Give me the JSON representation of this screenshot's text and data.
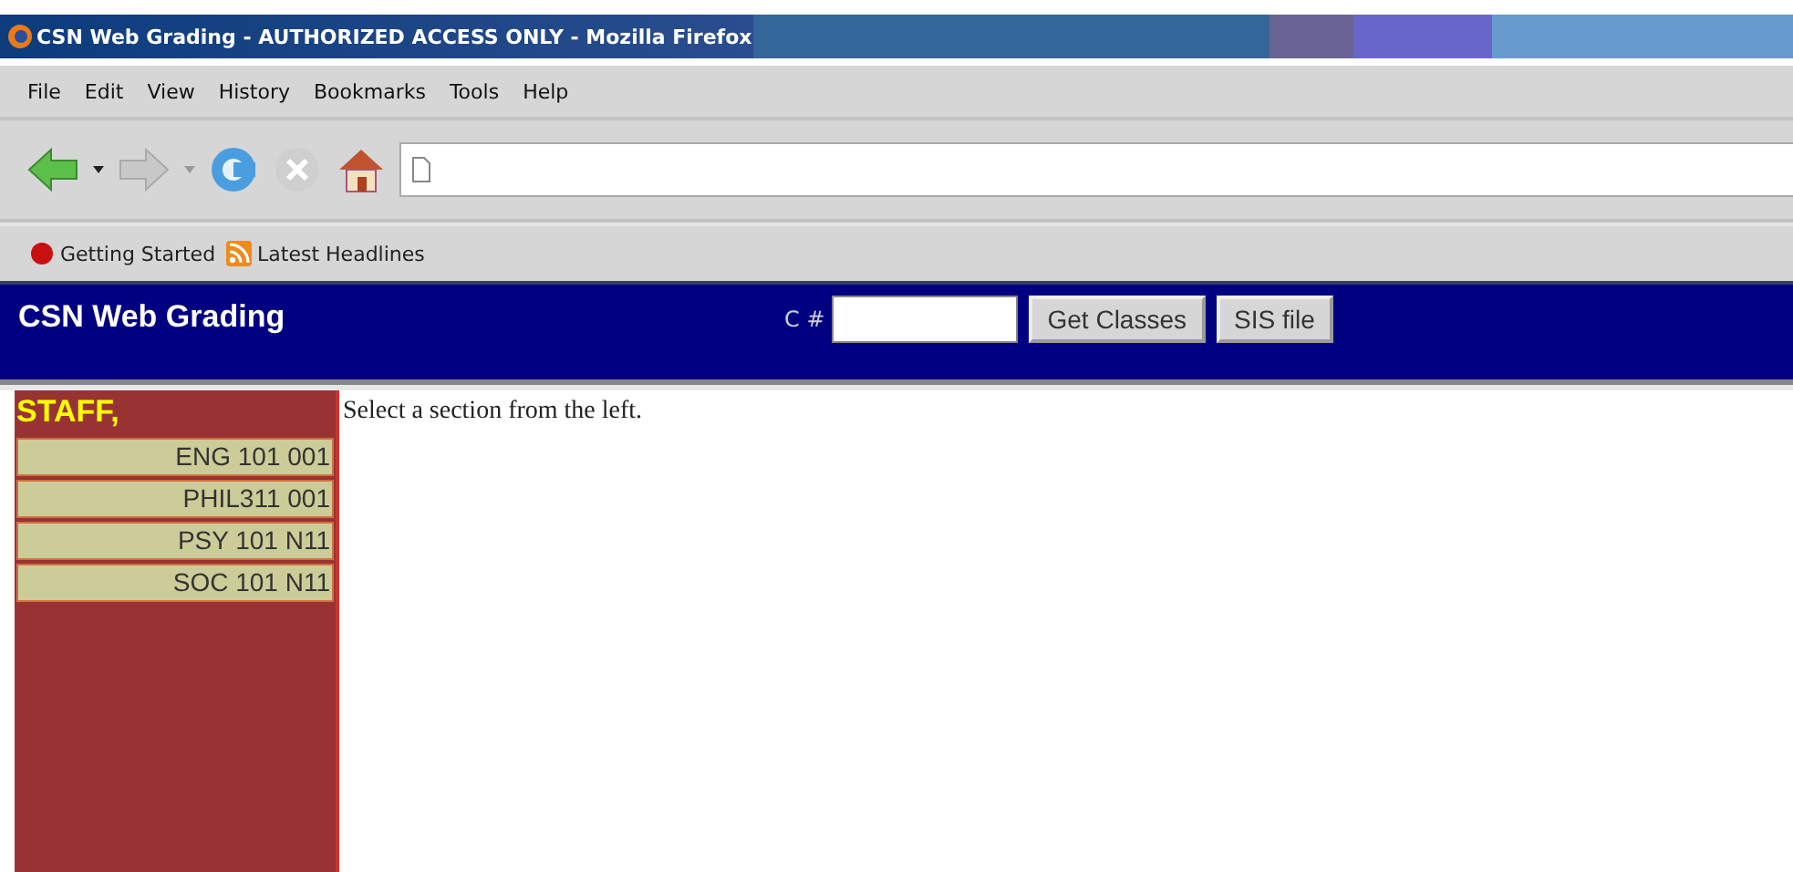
{
  "window": {
    "title": "CSN Web Grading - AUTHORIZED ACCESS ONLY - Mozilla Firefox"
  },
  "menu": [
    "File",
    "Edit",
    "View",
    "History",
    "Bookmarks",
    "Tools",
    "Help"
  ],
  "bookmarks": [
    {
      "label": "Getting Started",
      "kind": "start"
    },
    {
      "label": "Latest Headlines",
      "kind": "feed"
    }
  ],
  "header": {
    "title": "CSN Web Grading",
    "field_label": "C #",
    "buttons": [
      "Get Classes",
      "SIS file"
    ]
  },
  "sidebar": {
    "user": "STAFF,",
    "sections": [
      "ENG 101 001",
      "PHIL311 001",
      "PSY 101 N11",
      "SOC 101 N11"
    ]
  },
  "message": "Select a section from the left."
}
